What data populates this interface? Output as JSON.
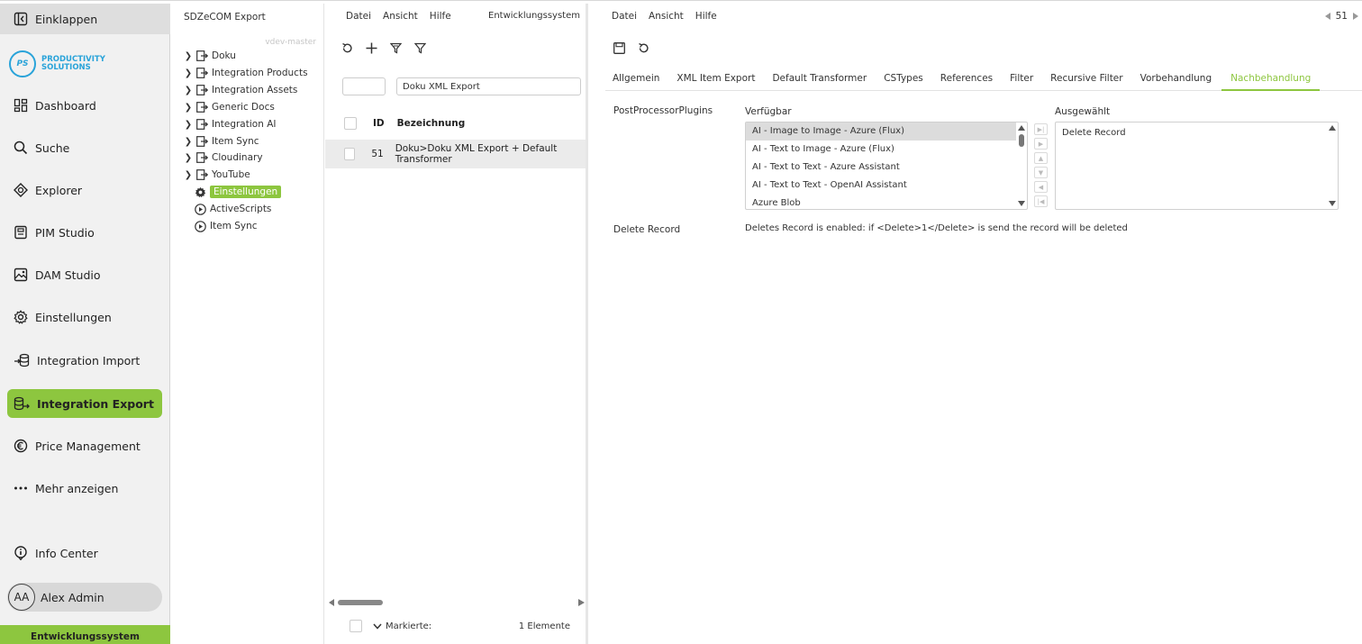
{
  "sidebar": {
    "collapse_label": "Einklappen",
    "logo_initials": "PS",
    "logo_line1": "PRODUCTIVITY",
    "logo_line2": "SOLUTIONS",
    "items": [
      {
        "label": "Dashboard",
        "icon": "dashboard-icon"
      },
      {
        "label": "Suche",
        "icon": "search-icon"
      },
      {
        "label": "Explorer",
        "icon": "explorer-icon"
      },
      {
        "label": "PIM Studio",
        "icon": "pim-icon"
      },
      {
        "label": "DAM Studio",
        "icon": "image-icon"
      },
      {
        "label": "Einstellungen",
        "icon": "gear-icon"
      },
      {
        "label": "Integration Import",
        "icon": "import-icon"
      },
      {
        "label": "Integration Export",
        "icon": "export-icon"
      },
      {
        "label": "Price Management",
        "icon": "euro-icon"
      },
      {
        "label": "Mehr anzeigen",
        "icon": "more-icon"
      }
    ],
    "info_center": "Info Center",
    "user_initials": "AA",
    "user_name": "Alex Admin",
    "environment": "Entwicklungssystem",
    "accent_color": "#8dc63f"
  },
  "tree": {
    "title": "SDZeCOM Export",
    "branch": "vdev-master",
    "items": [
      {
        "label": "Doku"
      },
      {
        "label": "Integration Products"
      },
      {
        "label": "Integration Assets"
      },
      {
        "label": "Generic Docs"
      },
      {
        "label": "Integration AI"
      },
      {
        "label": "Item Sync"
      },
      {
        "label": "Cloudinary"
      },
      {
        "label": "YouTube"
      },
      {
        "label": "Einstellungen"
      },
      {
        "label": "ActiveScripts"
      },
      {
        "label": "Item Sync"
      }
    ]
  },
  "list": {
    "menu": [
      "Datei",
      "Ansicht",
      "Hilfe"
    ],
    "environment": "Entwicklungssystem",
    "filter_value": "Doku XML Export",
    "columns": {
      "id": "ID",
      "name": "Bezeichnung"
    },
    "rows": [
      {
        "id": "51",
        "name": "Doku>Doku XML Export + Default Transformer"
      }
    ],
    "footer_marked": "Markierte:",
    "footer_count": "1 Elemente"
  },
  "detail": {
    "menu": [
      "Datei",
      "Ansicht",
      "Hilfe"
    ],
    "record_id": "51",
    "tabs": [
      "Allgemein",
      "XML Item Export",
      "Default Transformer",
      "CSTypes",
      "References",
      "Filter",
      "Recursive Filter",
      "Vorbehandlung",
      "Nachbehandlung"
    ],
    "active_tab": "Nachbehandlung",
    "plugins_label": "PostProcessorPlugins",
    "available_label": "Verfügbar",
    "selected_label": "Ausgewählt",
    "available": [
      "AI - Image to Image - Azure (Flux)",
      "AI - Text to Image - Azure (Flux)",
      "AI - Text to Text - Azure Assistant",
      "AI - Text to Text - OpenAI Assistant",
      "Azure Blob"
    ],
    "selected": [
      "Delete Record"
    ],
    "desc_label": "Delete Record",
    "desc_text": "Deletes Record is enabled: if <Delete>1</Delete> is send the record will be deleted"
  }
}
